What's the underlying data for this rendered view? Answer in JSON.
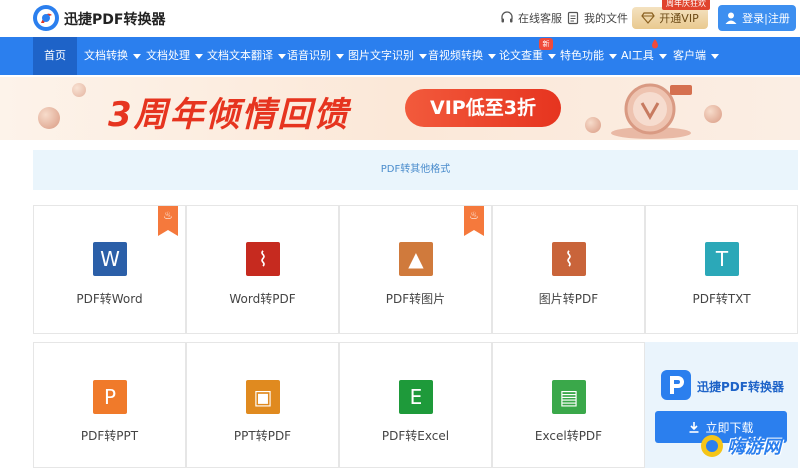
{
  "header": {
    "brand": "迅捷PDF转换器",
    "service_label": "在线客服",
    "files_label": "我的文件",
    "vip_label": "开通VIP",
    "vip_tag": "周年庆狂欢",
    "login_label": "登录|注册"
  },
  "nav": {
    "items": [
      {
        "label": "首页"
      },
      {
        "label": "文档转换"
      },
      {
        "label": "文档处理"
      },
      {
        "label": "文档文本翻译"
      },
      {
        "label": "语音识别"
      },
      {
        "label": "图片文字识别"
      },
      {
        "label": "音视频转换"
      },
      {
        "label": "论文查重",
        "badge": "新"
      },
      {
        "label": "特色功能"
      },
      {
        "label": "AI工具"
      },
      {
        "label": "客户端"
      }
    ]
  },
  "banner": {
    "title": "3周年倾情回馈",
    "pill": "VIP低至3折"
  },
  "section": {
    "title": "PDF转其他格式"
  },
  "tools": [
    {
      "label": "PDF转Word",
      "glyph": "W",
      "color": "#2b5fa8",
      "hot": true
    },
    {
      "label": "Word转PDF",
      "glyph": "⌇",
      "color": "#c62a1f",
      "hot": false
    },
    {
      "label": "PDF转图片",
      "glyph": "▲",
      "color": "#d07a3c",
      "hot": true
    },
    {
      "label": "图片转PDF",
      "glyph": "⌇",
      "color": "#c9643a",
      "hot": false
    },
    {
      "label": "PDF转TXT",
      "glyph": "T",
      "color": "#2ba8b8",
      "hot": false
    },
    {
      "label": "PDF转PPT",
      "glyph": "P",
      "color": "#f07a2a",
      "hot": false
    },
    {
      "label": "PPT转PDF",
      "glyph": "▣",
      "color": "#e08a1f",
      "hot": false
    },
    {
      "label": "PDF转Excel",
      "glyph": "E",
      "color": "#1e9a3a",
      "hot": false
    },
    {
      "label": "Excel转PDF",
      "glyph": "▤",
      "color": "#3aa84a",
      "hot": false
    }
  ],
  "promo": {
    "name": "迅捷PDF转换器",
    "download_label": "立即下载"
  },
  "watermark": {
    "text": "嗨游网"
  }
}
